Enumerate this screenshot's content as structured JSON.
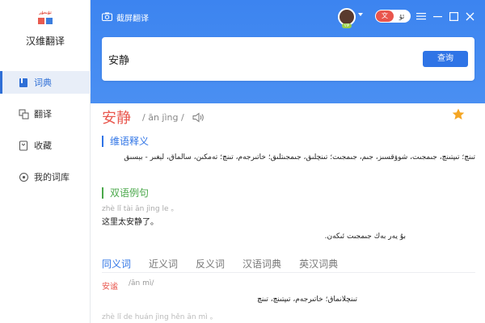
{
  "app": {
    "name": "汉维翻译"
  },
  "sidebar": {
    "items": [
      {
        "label": "词典",
        "icon": "book-icon"
      },
      {
        "label": "翻译",
        "icon": "translate-icon"
      },
      {
        "label": "收藏",
        "icon": "bookmark-icon"
      },
      {
        "label": "我的词库",
        "icon": "library-icon"
      }
    ]
  },
  "header": {
    "capture_label": "截屏翻译",
    "lang_on": "文",
    "lang_off": "ئۇ",
    "vip": "VIP"
  },
  "search": {
    "value": "安静",
    "button_label": "查询"
  },
  "entry": {
    "word": "安静",
    "pinyin": "/ ān jìng /",
    "definition_title": "维语释义",
    "definition": "تىنچ؛ تىپتىنچ، جىمجىت، شوۋقسىز، جىم، جىمجىت؛ تىنچلىق، جىمجىتلىق؛ خاتىرجەم، تىنچ؛ تەمكىن، سالماق، لېغىر - بېسىق",
    "example_title": "双语例句",
    "example_pinyin": "zhè lǐ tài ān jìng le 。",
    "example_cn": "这里太安静了。",
    "example_ug": "بۇ يەر بەك جىمجىت ئىكەن."
  },
  "tabs": [
    "同义词",
    "近义词",
    "反义词",
    "汉语词典",
    "英汉词典"
  ],
  "synonym": {
    "word": "安谧",
    "pinyin": "/ān mì/",
    "ug": "تىنچلانماق؛ خاتىرجەم، تىپتىنچ، تىنچ",
    "next_pinyin": "zhè lǐ de huán jìng hěn ān mì 。"
  },
  "colors": {
    "accent": "#2f74e6",
    "headword": "#e9584f",
    "example_green": "#4aa84a",
    "star": "#f5a623"
  }
}
